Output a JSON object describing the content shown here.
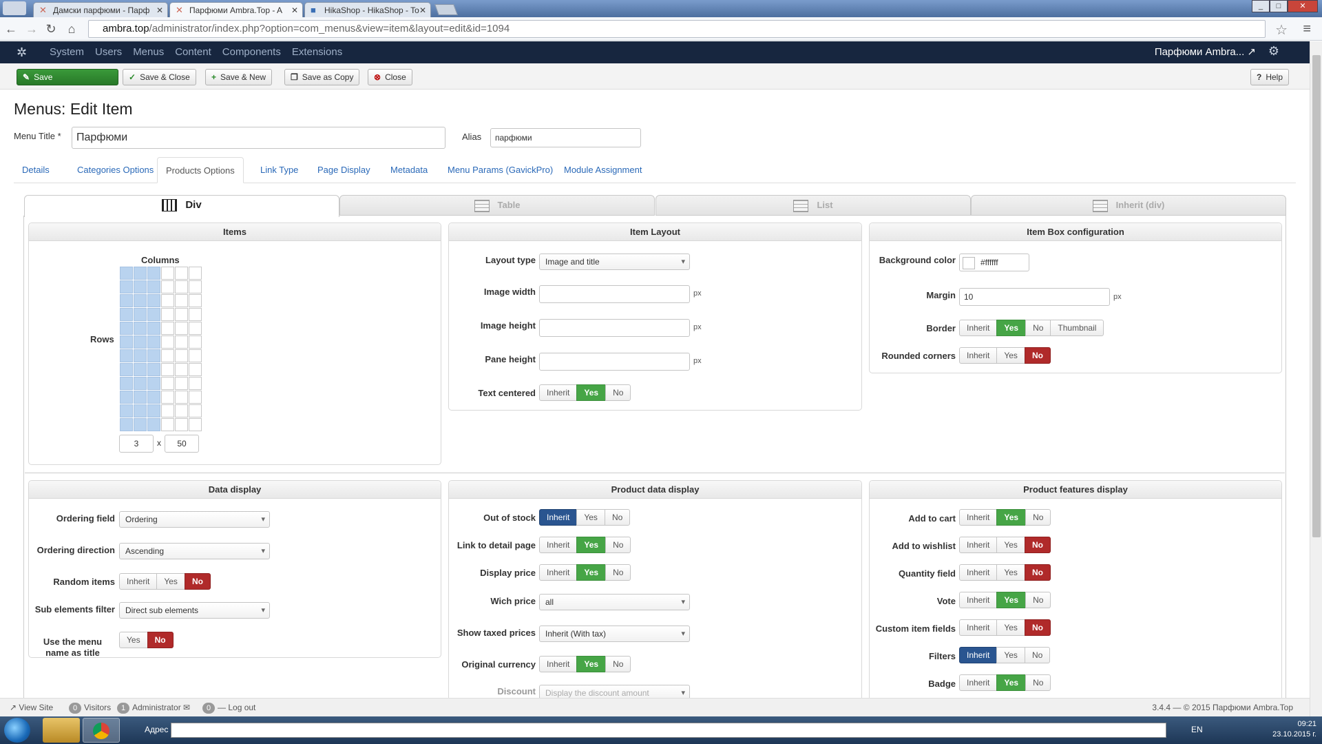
{
  "browser": {
    "tabs": [
      {
        "title": "Дамски парфюми - Парф"
      },
      {
        "title": "Парфюми Ambra.Top - A"
      },
      {
        "title": "HikaShop - HikaShop - To"
      }
    ],
    "url_host": "ambra.top",
    "url_rest": "/administrator/index.php?option=com_menus&view=item&layout=edit&id=1094"
  },
  "navbar": {
    "menu": [
      "System",
      "Users",
      "Menus",
      "Content",
      "Components",
      "Extensions"
    ],
    "site_name": "Парфюми Ambra...",
    "site_icon": "external-link-icon"
  },
  "toolbar": {
    "save": "Save",
    "save_close": "Save & Close",
    "save_new": "Save & New",
    "save_copy": "Save as Copy",
    "close": "Close",
    "help": "Help"
  },
  "page": {
    "title": "Menus: Edit Item",
    "menu_title_label": "Menu Title *",
    "menu_title_value": "Парфюми",
    "alias_label": "Alias",
    "alias_value": "парфюми"
  },
  "tabs": [
    "Details",
    "Categories Options",
    "Products Options",
    "Link Type",
    "Page Display",
    "Metadata",
    "Menu Params (GavickPro)",
    "Module Assignment"
  ],
  "layout_tabs": [
    "Div",
    "Table",
    "List",
    "Inherit (div)"
  ],
  "items": {
    "title": "Items",
    "columns_label": "Columns",
    "rows_label": "Rows",
    "cols_value": "3",
    "x": "x",
    "rows_value": "50"
  },
  "item_layout": {
    "title": "Item Layout",
    "layout_type_label": "Layout type",
    "layout_type_value": "Image and title",
    "image_width_label": "Image width",
    "image_height_label": "Image height",
    "pane_height_label": "Pane height",
    "px": "px",
    "text_centered_label": "Text centered"
  },
  "item_box": {
    "title": "Item Box configuration",
    "bg_color_label": "Background color",
    "bg_color_value": "#ffffff",
    "margin_label": "Margin",
    "margin_value": "10",
    "border_label": "Border",
    "rounded_label": "Rounded corners"
  },
  "data_display": {
    "title": "Data display",
    "ordering_field_label": "Ordering field",
    "ordering_field_value": "Ordering",
    "ordering_dir_label": "Ordering direction",
    "ordering_dir_value": "Ascending",
    "random_label": "Random items",
    "sub_filter_label": "Sub elements filter",
    "sub_filter_value": "Direct sub elements",
    "menu_name_label_1": "Use the menu",
    "menu_name_label_2": "name as title"
  },
  "product_data": {
    "title": "Product data display",
    "out_of_stock": "Out of stock",
    "link_detail": "Link to detail page",
    "display_price": "Display price",
    "which_price": "Wich price",
    "which_price_value": "all",
    "show_taxed": "Show taxed prices",
    "show_taxed_value": "Inherit (With tax)",
    "orig_currency": "Original currency",
    "discount": "Discount",
    "discount_value": "Display the discount amount"
  },
  "features": {
    "title": "Product features display",
    "add_to_cart": "Add to cart",
    "add_to_wishlist": "Add to wishlist",
    "quantity_field": "Quantity field",
    "vote": "Vote",
    "custom_fields": "Custom item fields",
    "filters": "Filters",
    "badge": "Badge"
  },
  "buttons": {
    "inherit": "Inherit",
    "yes": "Yes",
    "no": "No",
    "thumbnail": "Thumbnail"
  },
  "status": {
    "view_site": "View Site",
    "visitors_count": "0",
    "visitors": "Visitors",
    "admin_count": "1",
    "administrator": "Administrator",
    "msg_count": "0",
    "logout": "Log out",
    "copyright": "3.4.4 — © 2015 Парфюми Ambra.Top"
  },
  "taskbar": {
    "address_label": "Адрес",
    "lang": "EN",
    "time": "09:21",
    "date": "23.10.2015 г."
  }
}
